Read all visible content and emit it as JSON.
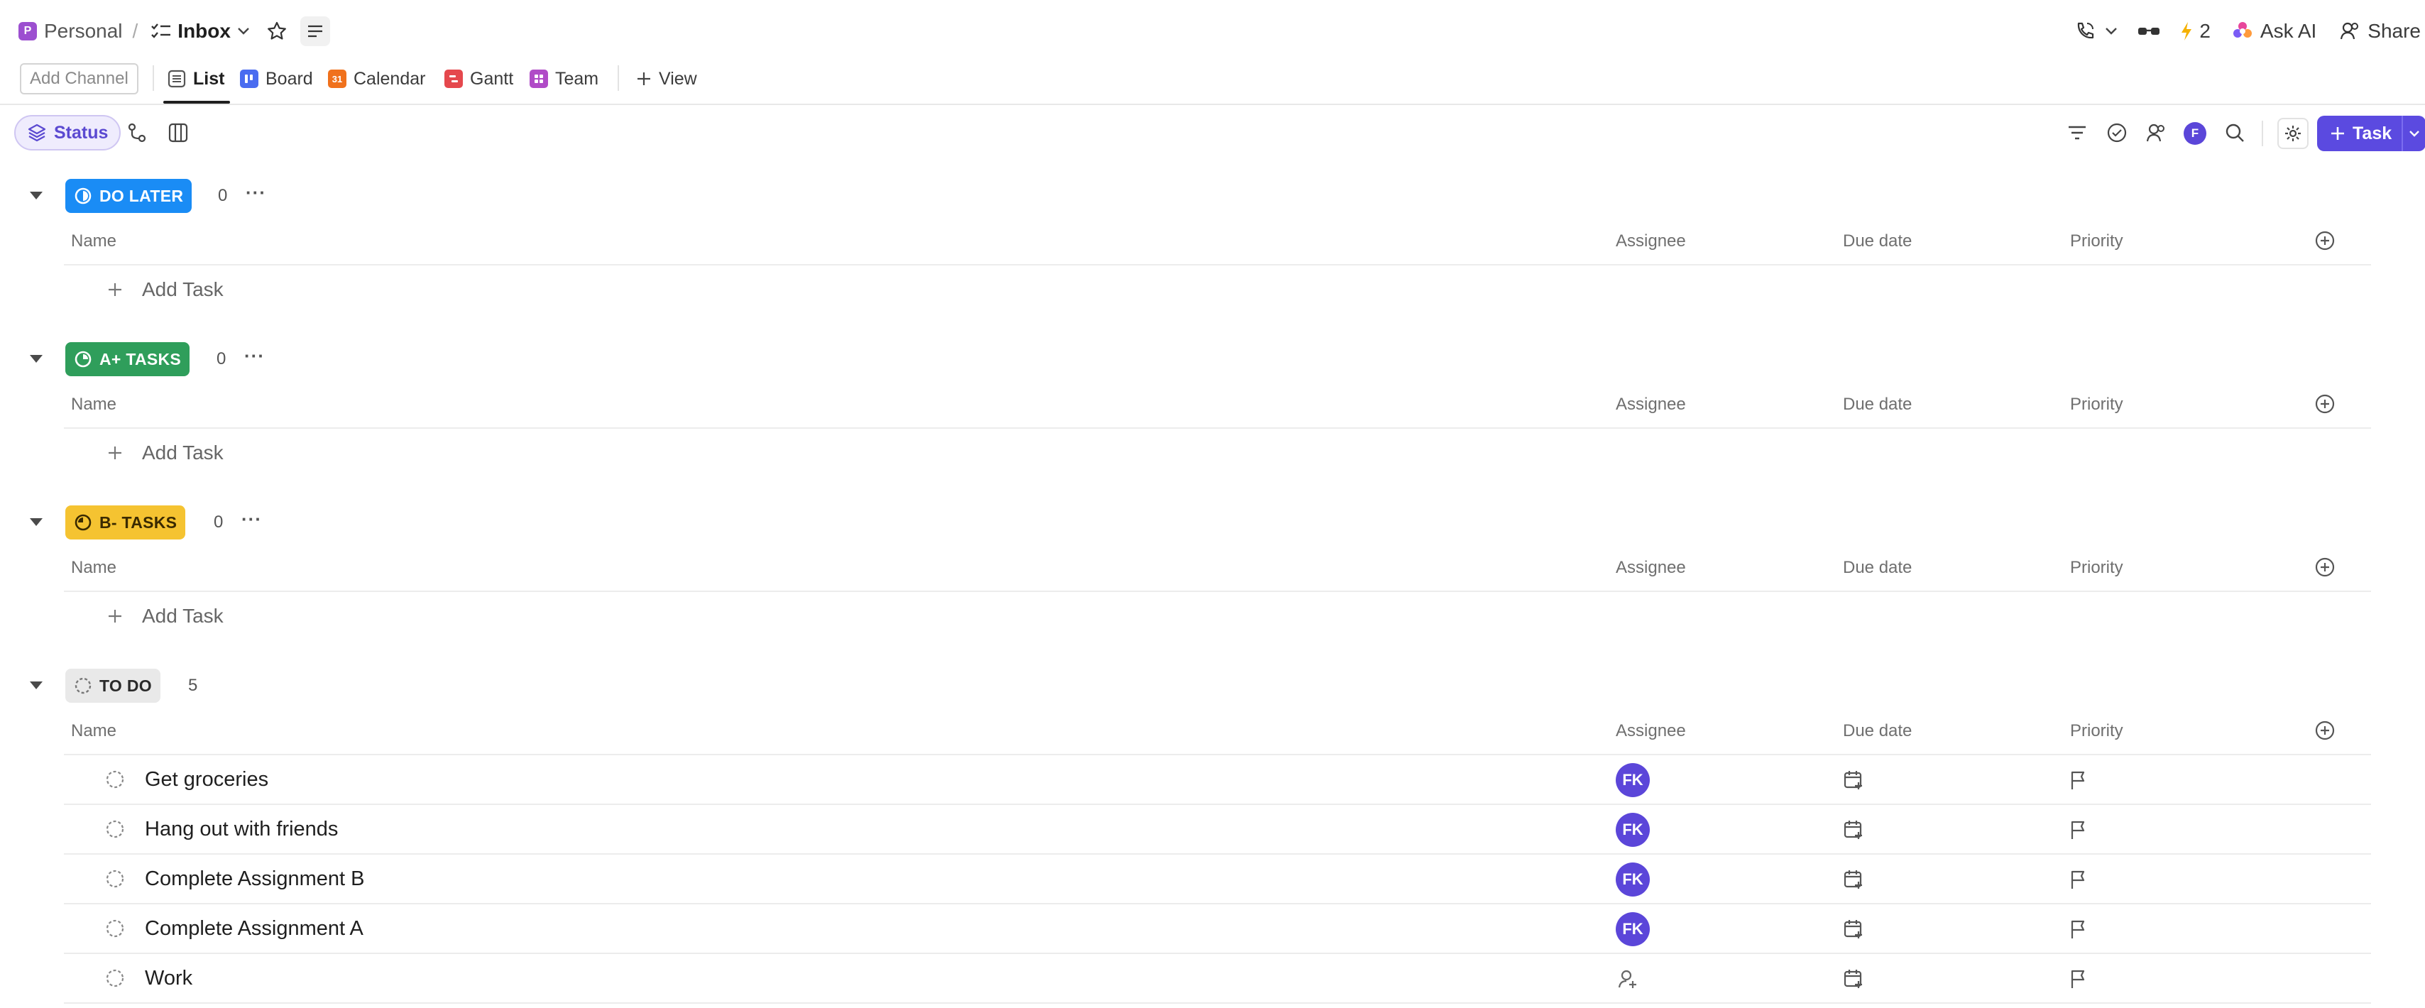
{
  "breadcrumb": {
    "space_initial": "P",
    "space_name": "Personal",
    "separator": "/",
    "list_name": "Inbox"
  },
  "topbar": {
    "automations_count": "2",
    "ask_ai_label": "Ask AI",
    "share_label": "Share"
  },
  "views": {
    "add_channel_label": "Add Channel",
    "tabs": [
      {
        "label": "List",
        "icon": "list-icon",
        "color": "#6b6b6b",
        "active": true
      },
      {
        "label": "Board",
        "icon": "board-icon",
        "color": "#4a6cf0"
      },
      {
        "label": "Calendar",
        "icon": "calendar-icon",
        "color": "#f0711c",
        "icon_text": "31"
      },
      {
        "label": "Gantt",
        "icon": "gantt-icon",
        "color": "#e5484d"
      },
      {
        "label": "Team",
        "icon": "team-icon",
        "color": "#b04bc7"
      }
    ],
    "add_view_label": "View"
  },
  "toolbar": {
    "group_by_label": "Status",
    "user_initial": "F",
    "task_button_label": "Task"
  },
  "columns": {
    "name": "Name",
    "assignee": "Assignee",
    "due_date": "Due date",
    "priority": "Priority"
  },
  "add_task_label": "Add Task",
  "groups": [
    {
      "label": "DO LATER",
      "count": "0",
      "color": "#1a8cf5"
    },
    {
      "label": "A+ TASKS",
      "count": "0",
      "color": "#2f9e5b"
    },
    {
      "label": "B- TASKS",
      "count": "0",
      "color": "#f5c331"
    },
    {
      "label": "TO DO",
      "count": "5",
      "color": "#e9e9e9"
    }
  ],
  "tasks": [
    {
      "name": "Get groceries",
      "assignee": "FK"
    },
    {
      "name": "Hang out with friends",
      "assignee": "FK"
    },
    {
      "name": "Complete Assignment B",
      "assignee": "FK"
    },
    {
      "name": "Complete Assignment A",
      "assignee": "FK"
    },
    {
      "name": "Work",
      "assignee": ""
    }
  ],
  "colors": {
    "accent": "#5b4ae0",
    "do_later": "#1a8cf5",
    "a_tasks": "#2f9e5b",
    "b_tasks": "#f5c331"
  }
}
